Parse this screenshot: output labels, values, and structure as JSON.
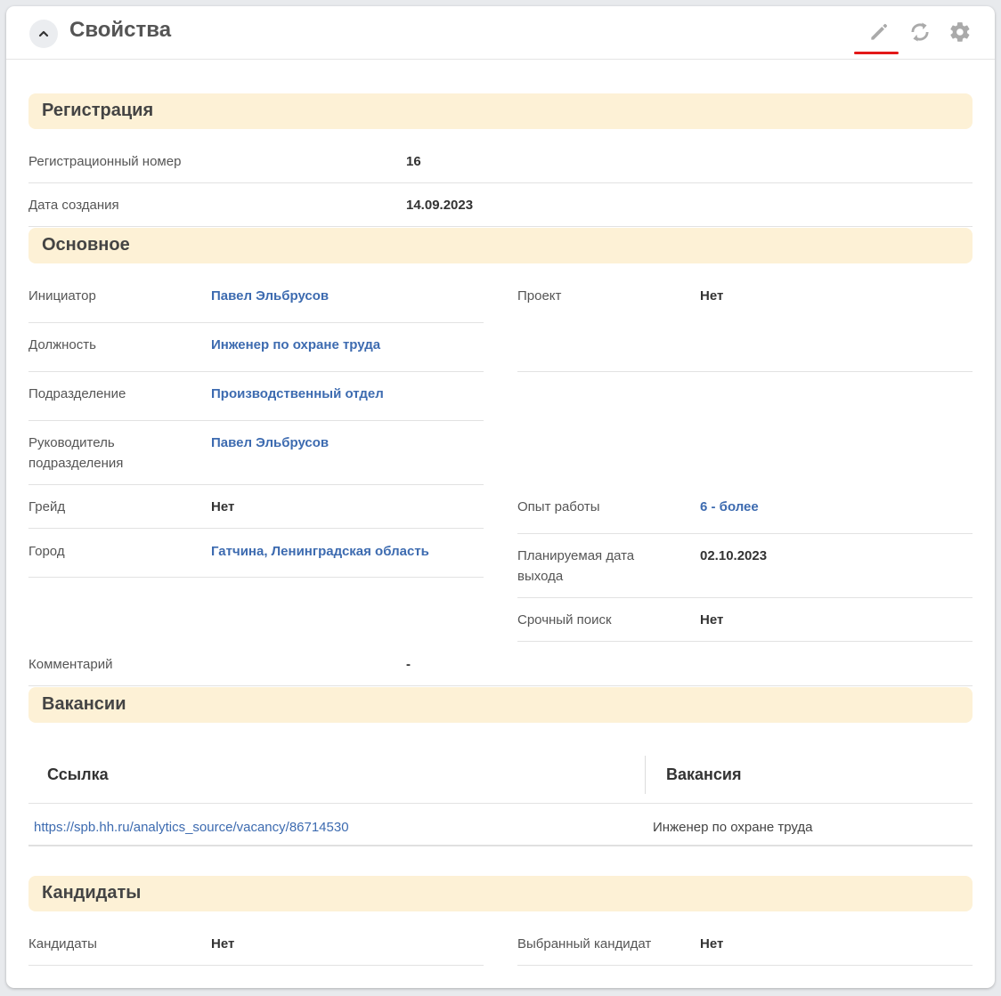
{
  "header": {
    "title": "Свойства"
  },
  "registration": {
    "section_title": "Регистрация",
    "reg_number_label": "Регистрационный номер",
    "reg_number_value": "16",
    "created_label": "Дата создания",
    "created_value": "14.09.2023"
  },
  "main": {
    "section_title": "Основное",
    "initiator_label": "Инициатор",
    "initiator_value": "Павел Эльбрусов",
    "position_label": "Должность",
    "position_value": "Инженер по охране труда",
    "department_label": "Подразделение",
    "department_value": "Производственный отдел",
    "head_label_1": "Руководитель",
    "head_label_2": "подразделения",
    "head_value": "Павел Эльбрусов",
    "grade_label": "Грейд",
    "grade_value": "Нет",
    "city_label": "Город",
    "city_value": "Гатчина, Ленинградская область",
    "project_label": "Проект",
    "project_value": "Нет",
    "experience_label": "Опыт работы",
    "experience_value": "6 - более",
    "planned_date_label_1": "Планируемая дата",
    "planned_date_label_2": "выхода",
    "planned_date_value": "02.10.2023",
    "urgent_label": "Срочный поиск",
    "urgent_value": "Нет",
    "comment_label": "Комментарий",
    "comment_value": "-"
  },
  "vacancies": {
    "section_title": "Вакансии",
    "columns": [
      "Ссылка",
      "Вакансия"
    ],
    "rows": [
      {
        "link": "https://spb.hh.ru/analytics_source/vacancy/86714530",
        "vacancy": "Инженер по охране труда"
      }
    ]
  },
  "candidates": {
    "section_title": "Кандидаты",
    "candidates_label": "Кандидаты",
    "candidates_value": "Нет",
    "selected_label": "Выбранный кандидат",
    "selected_value": "Нет"
  },
  "colors": {
    "section_band": "#fdf1d6",
    "link": "#3d6bb0",
    "active_underline": "#e31818"
  },
  "icons": {
    "collapse": "chevron-up-icon",
    "edit": "pencil-icon",
    "refresh": "refresh-icon",
    "settings": "gear-icon"
  }
}
